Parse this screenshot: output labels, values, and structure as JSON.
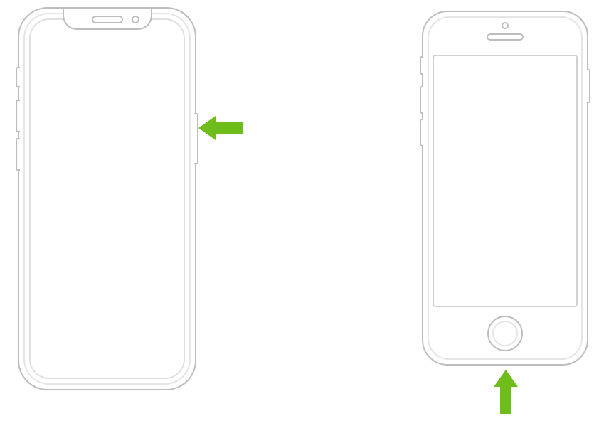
{
  "devices": [
    {
      "name": "iphone-face-id",
      "callout": {
        "target": "side-button",
        "direction": "left",
        "color": "#6ebd1a"
      }
    },
    {
      "name": "iphone-touch-id",
      "callout": {
        "target": "home-button",
        "direction": "up",
        "color": "#6ebd1a"
      }
    }
  ],
  "colors": {
    "arrow_green": "#6ebd1a",
    "outline_gray": "#bdbdbd",
    "outline_light": "#e5e5e5"
  },
  "alt": {
    "faceid": "iPhone with Face ID, arrow pointing to side button",
    "touchid": "iPhone with Home button, arrow pointing to Home button"
  }
}
